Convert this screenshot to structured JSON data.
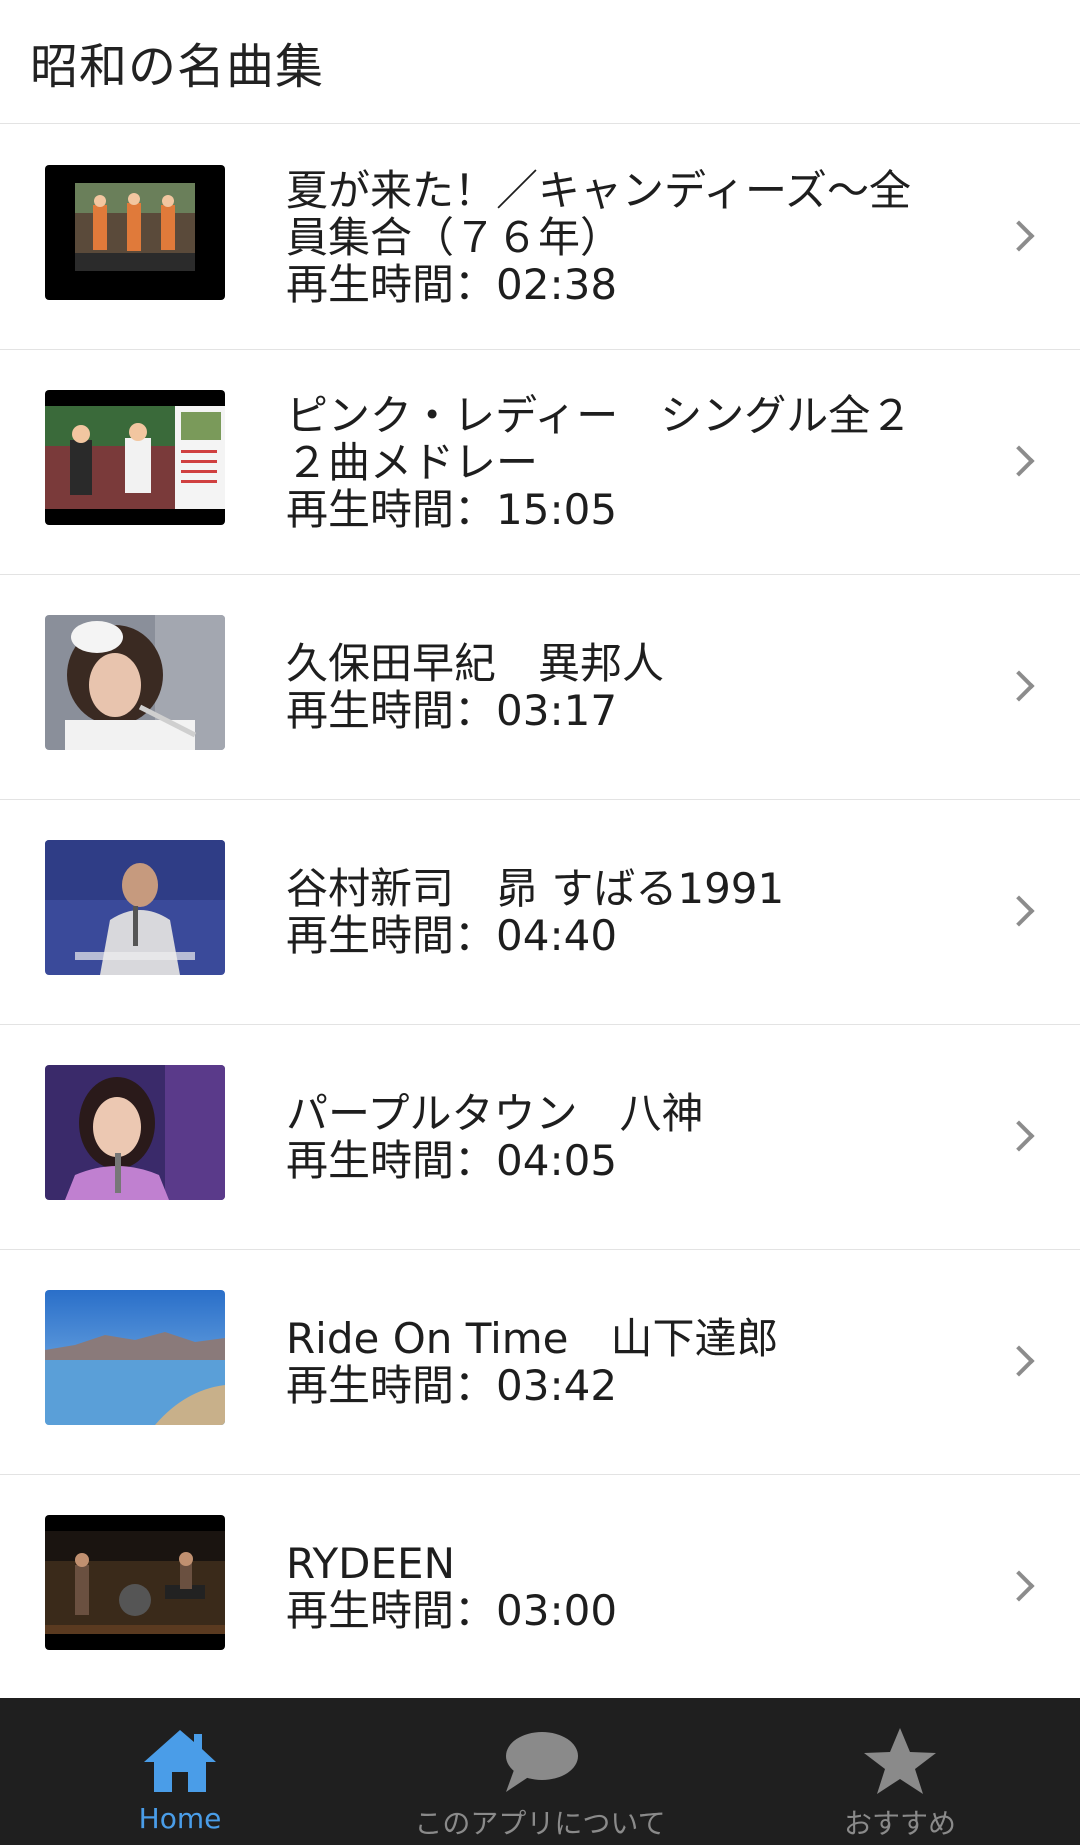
{
  "header": {
    "title": "昭和の名曲集"
  },
  "items": [
    {
      "title_line1": "夏が来た！／キャンディーズ〜全",
      "title_line2": "員集合（７６年）",
      "duration": "再生時間：02:38",
      "thumb_icon": "concert-stage-thumbnail"
    },
    {
      "title_line1": "ピンク・レディー　シングル全２",
      "title_line2": "２曲メドレー",
      "duration": "再生時間：15:05",
      "thumb_icon": "duo-performers-thumbnail"
    },
    {
      "title_line1": "久保田早紀　異邦人",
      "title_line2": "",
      "duration": "再生時間：03:17",
      "thumb_icon": "singer-portrait-thumbnail"
    },
    {
      "title_line1": "谷村新司　昴 すばる1991",
      "title_line2": "",
      "duration": "再生時間：04:40",
      "thumb_icon": "male-singer-thumbnail"
    },
    {
      "title_line1": "パープルタウン　八神",
      "title_line2": "",
      "duration": "再生時間：04:05",
      "thumb_icon": "female-singer-thumbnail"
    },
    {
      "title_line1": "Ride On Time　山下達郎",
      "title_line2": "",
      "duration": "再生時間：03:42",
      "thumb_icon": "landscape-thumbnail"
    },
    {
      "title_line1": "RYDEEN",
      "title_line2": "",
      "duration": "再生時間：03:00",
      "thumb_icon": "band-stage-thumbnail"
    }
  ],
  "tabs": [
    {
      "label": "Home",
      "icon": "home-icon",
      "active": true
    },
    {
      "label": "このアプリについて",
      "icon": "speech-bubble-icon",
      "active": false
    },
    {
      "label": "おすすめ",
      "icon": "star-icon",
      "active": false
    }
  ],
  "colors": {
    "accent": "#4a9de8",
    "tabbar_bg": "#1f1f1f",
    "inactive": "#8a8a8a"
  }
}
